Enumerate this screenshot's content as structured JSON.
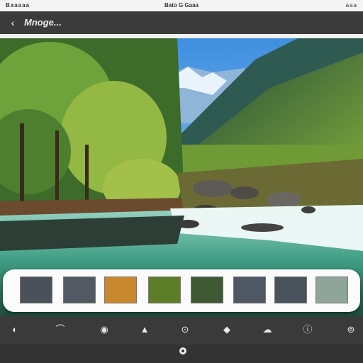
{
  "status": {
    "left": "Baaaaa",
    "center": "Bato G Gaaa",
    "right": "aaa"
  },
  "header": {
    "title": "Mnoge..."
  },
  "icons": {
    "back": "chevron-left-icon"
  },
  "palette": {
    "swatches": [
      {
        "name": "swatch-slate-1",
        "color": "#4a5158"
      },
      {
        "name": "swatch-slate-2",
        "color": "#515a63"
      },
      {
        "name": "swatch-amber",
        "color": "#c8882e"
      },
      {
        "name": "swatch-green",
        "color": "#5e7d28"
      },
      {
        "name": "swatch-dark-green",
        "color": "#3e5a34"
      },
      {
        "name": "swatch-slate-3",
        "color": "#4e5864"
      },
      {
        "name": "swatch-slate-4",
        "color": "#4a535c"
      },
      {
        "name": "swatch-sage",
        "color": "#8fa59a"
      }
    ]
  },
  "toolbar": {
    "tools": [
      {
        "name": "drop-icon",
        "glyph": "◐"
      },
      {
        "name": "horizon-icon",
        "glyph": "⌒"
      },
      {
        "name": "camera-icon",
        "glyph": "◉"
      },
      {
        "name": "mountain-icon",
        "glyph": "▲"
      },
      {
        "name": "focus-icon",
        "glyph": "⊙"
      },
      {
        "name": "shape-icon",
        "glyph": "◆"
      },
      {
        "name": "cloud-icon",
        "glyph": "☁"
      },
      {
        "name": "info-icon",
        "glyph": "ⓘ"
      },
      {
        "name": "more-icon",
        "glyph": "⊚"
      }
    ]
  }
}
